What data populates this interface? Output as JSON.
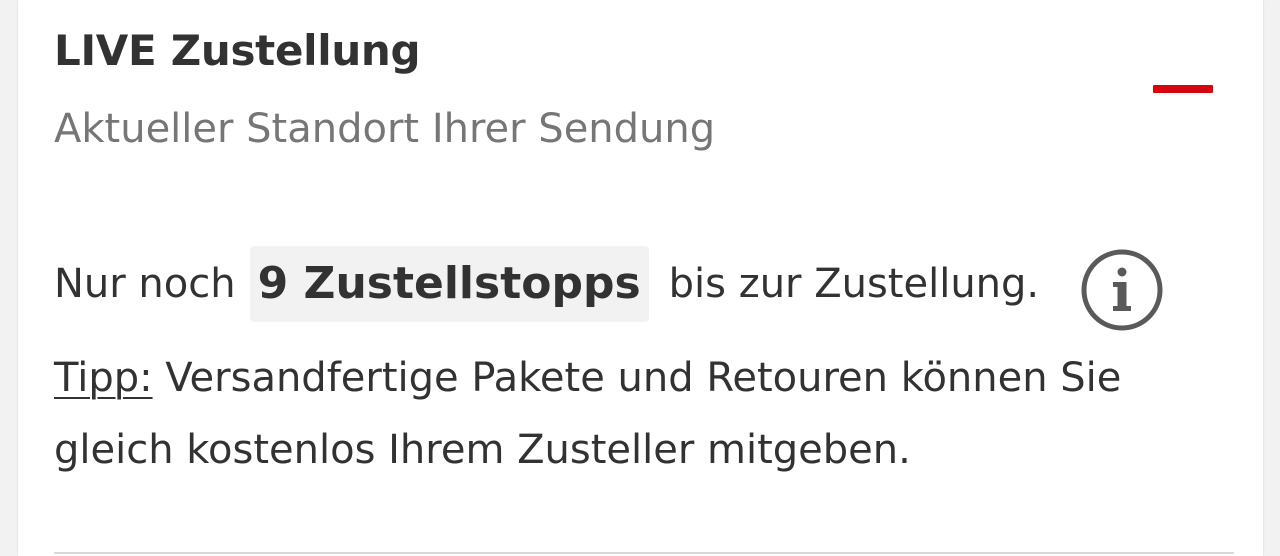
{
  "header": {
    "title": "LIVE Zustellung",
    "subtitle": "Aktueller Standort Ihrer Sendung",
    "collapse_icon": "minus-icon"
  },
  "stops": {
    "prefix": "Nur noch",
    "count_label": "9 Zustellstopps",
    "suffix": "bis zur Zustellung.",
    "info_icon": "info-icon"
  },
  "tip": {
    "label": "Tipp:",
    "text": " Versandfertige Pakete und Retouren können Sie gleich kostenlos Ihrem Zusteller mitgeben."
  },
  "colors": {
    "accent": "#d40511",
    "text": "#323232",
    "muted": "#767676",
    "badge_bg": "#f2f2f2"
  }
}
